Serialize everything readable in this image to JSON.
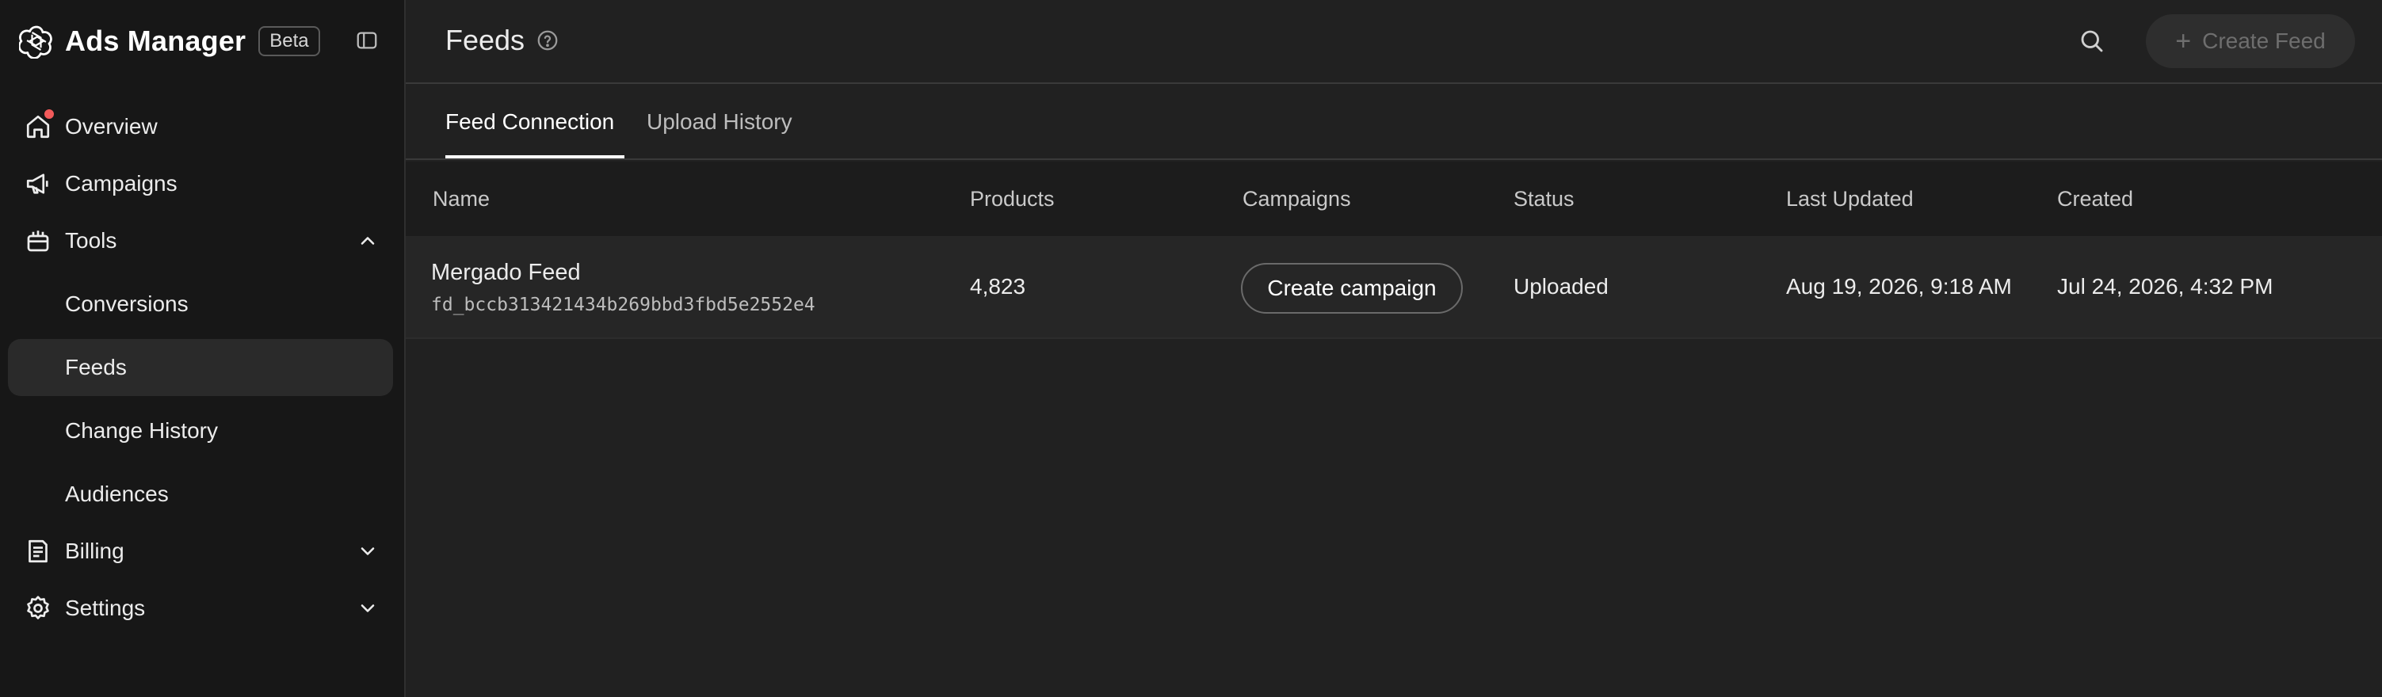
{
  "brand": {
    "title": "Ads Manager",
    "badge": "Beta"
  },
  "sidebar": {
    "items": [
      {
        "label": "Overview",
        "icon": "home-icon"
      },
      {
        "label": "Campaigns",
        "icon": "megaphone-icon"
      },
      {
        "label": "Tools",
        "icon": "tools-icon",
        "expanded": true
      },
      {
        "label": "Conversions"
      },
      {
        "label": "Feeds",
        "active": true
      },
      {
        "label": "Change History"
      },
      {
        "label": "Audiences"
      },
      {
        "label": "Billing",
        "icon": "receipt-icon",
        "expanded": false
      },
      {
        "label": "Settings",
        "icon": "gear-icon",
        "expanded": false
      }
    ]
  },
  "header": {
    "title": "Feeds",
    "create_feed_label": "Create Feed"
  },
  "tabs": [
    {
      "label": "Feed Connection",
      "active": true
    },
    {
      "label": "Upload History",
      "active": false
    }
  ],
  "table": {
    "columns": [
      "Name",
      "Products",
      "Campaigns",
      "Status",
      "Last Updated",
      "Created"
    ],
    "rows": [
      {
        "name": "Mergado Feed",
        "id": "fd_bccb313421434b269bbd3fbd5e2552e4",
        "products": "4,823",
        "campaign_action": "Create campaign",
        "status": "Uploaded",
        "last_updated": "Aug 19, 2026, 9:18 AM",
        "created": "Jul 24, 2026, 4:32 PM"
      }
    ]
  },
  "colors": {
    "sidebar_bg": "#171717",
    "main_bg": "#212121",
    "active_item_bg": "#2a2a2a",
    "notification_dot": "#f25a5a"
  }
}
